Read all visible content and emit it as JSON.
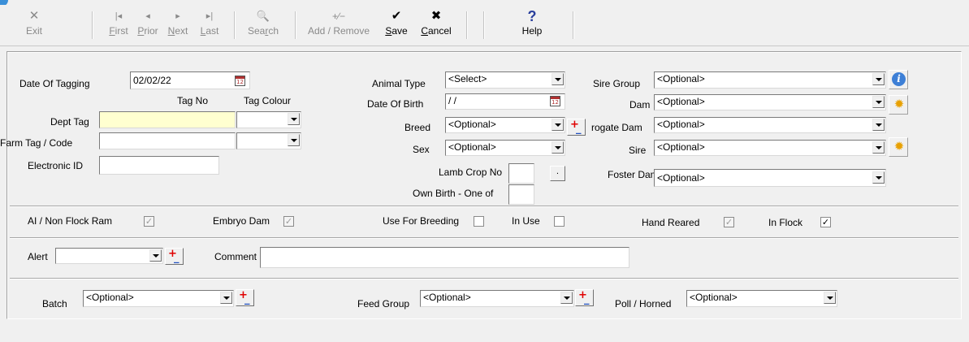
{
  "toolbar": {
    "exit": {
      "icon": "✕",
      "label": "Exit"
    },
    "first": {
      "icon": "|◂",
      "label": "First",
      "u": "F",
      "rest": "irst"
    },
    "prior": {
      "icon": "◂",
      "label": "Prior",
      "u": "P",
      "rest": "rior"
    },
    "next": {
      "icon": "▸",
      "label": "Next",
      "u": "N",
      "rest": "ext"
    },
    "last": {
      "icon": "▸|",
      "label": "Last",
      "u": "L",
      "rest": "ast"
    },
    "search": {
      "icon": "🔍",
      "label": "Search",
      "pre": "Sea",
      "u": "r",
      "rest": "ch"
    },
    "add_remove": {
      "icon": "+∕−",
      "label": "Add / Remove"
    },
    "save": {
      "icon": "✔",
      "label": "Save",
      "u": "S",
      "rest": "ave"
    },
    "cancel": {
      "icon": "✖",
      "label": "Cancel",
      "u": "C",
      "rest": "ancel"
    },
    "help": {
      "icon": "?",
      "label": "Help"
    }
  },
  "form": {
    "date_of_tagging": {
      "label": "Date Of Tagging",
      "value": "02/02/22"
    },
    "tag_no_header": "Tag No",
    "tag_colour_header": "Tag Colour",
    "dept_tag": {
      "label": "Dept Tag",
      "value": "",
      "colour": ""
    },
    "farm_tag": {
      "label": "Farm Tag / Code",
      "value": "",
      "colour": ""
    },
    "electronic_id": {
      "label": "Electronic ID",
      "value": ""
    },
    "animal_type": {
      "label": "Animal Type",
      "value": "<Select>"
    },
    "date_of_birth": {
      "label": "Date Of Birth",
      "value": " / /"
    },
    "breed": {
      "label": "Breed",
      "value": "<Optional>"
    },
    "sex": {
      "label": "Sex",
      "value": "<Optional>"
    },
    "lamb_crop_no": {
      "label": "Lamb Crop No",
      "value": "",
      "button": "."
    },
    "own_birth": {
      "label": "Own Birth - One of",
      "value": ""
    },
    "sire_group": {
      "label": "Sire Group",
      "value": "<Optional>"
    },
    "dam": {
      "label": "Dam",
      "value": "<Optional>"
    },
    "surrogate_dam": {
      "label": "rogate Dam",
      "value": "<Optional>"
    },
    "sire": {
      "label": "Sire",
      "value": "<Optional>"
    },
    "foster_dam": {
      "label": "Foster Dam",
      "value": "<Optional>"
    },
    "ai_non_flock_ram": {
      "label": "AI / Non Flock Ram",
      "checked": true,
      "mark": "✓"
    },
    "embryo_dam": {
      "label": "Embryo Dam",
      "checked": true,
      "mark": "✓"
    },
    "use_for_breeding": {
      "label": "Use For Breeding",
      "checked": false,
      "mark": ""
    },
    "in_use": {
      "label": "In Use",
      "checked": false,
      "mark": ""
    },
    "hand_reared": {
      "label": "Hand Reared",
      "checked": true,
      "mark": "✓"
    },
    "in_flock": {
      "label": "In Flock",
      "checked": true,
      "mark": "✓"
    },
    "alert": {
      "label": "Alert",
      "value": ""
    },
    "comment": {
      "label": "Comment",
      "value": ""
    },
    "batch": {
      "label": "Batch",
      "value": "<Optional>"
    },
    "feed_group": {
      "label": "Feed Group",
      "value": "<Optional>"
    },
    "poll_horned": {
      "label": "Poll / Horned",
      "value": "<Optional>"
    }
  },
  "colors": {
    "required_field": "#ffffd0",
    "background": "#f0f0f0"
  }
}
